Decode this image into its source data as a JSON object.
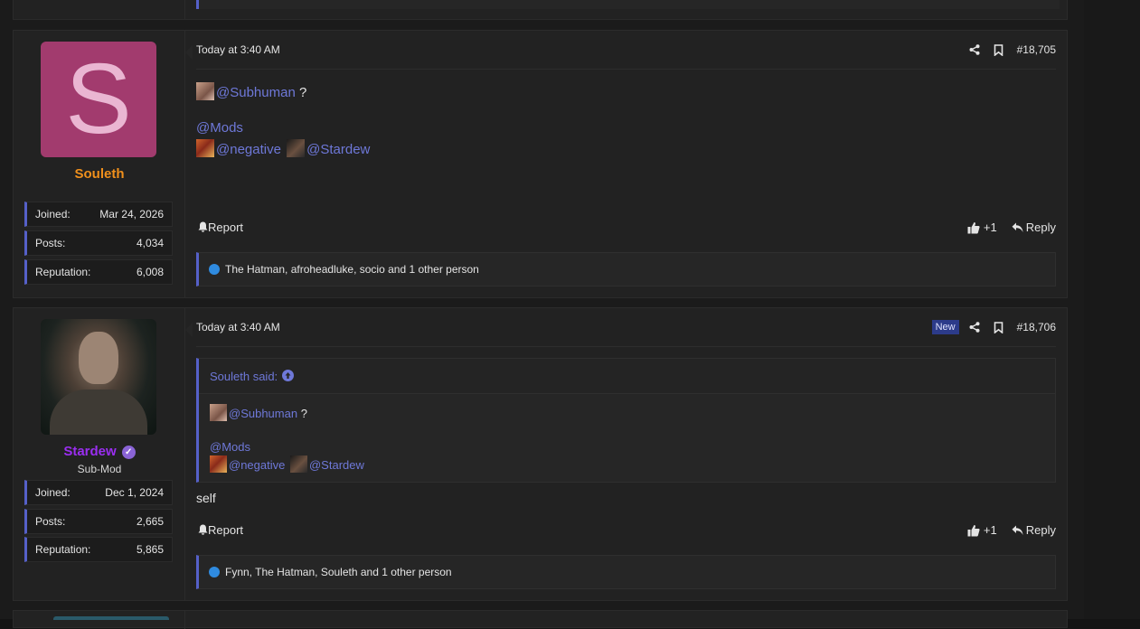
{
  "posts": [
    {
      "date": "Today at 3:40 AM",
      "post_number": "#18,705",
      "user": {
        "avatar_letter": "S",
        "avatar_color": "#a23b6e",
        "name": "Souleth",
        "name_color": "#f0901c",
        "stats": [
          {
            "label": "Joined:",
            "value": "Mar 24, 2026"
          },
          {
            "label": "Posts:",
            "value": "4,034"
          },
          {
            "label": "Reputation:",
            "value": "6,008"
          }
        ]
      },
      "body": {
        "line1_mention": "@Subhuman",
        "line1_after": " ?",
        "line2_mention": "@Mods",
        "line3_mention_a": "@negative",
        "line3_mention_b": "@Stardew"
      },
      "actions": {
        "report": "Report",
        "like_count": "+1",
        "reply": "Reply"
      },
      "reactions": "The Hatman, afroheadluke, socio and 1 other person"
    },
    {
      "date": "Today at 3:40 AM",
      "new_badge": "New",
      "post_number": "#18,706",
      "user": {
        "name": "Stardew",
        "name_color": "#9a2ef0",
        "title": "Sub-Mod",
        "stats": [
          {
            "label": "Joined:",
            "value": "Dec 1, 2024"
          },
          {
            "label": "Posts:",
            "value": "2,665"
          },
          {
            "label": "Reputation:",
            "value": "5,865"
          }
        ]
      },
      "quote": {
        "author": "Souleth said:",
        "line1_mention": "@Subhuman",
        "line1_after": " ?",
        "line2_mention": "@Mods",
        "line3_mention_a": "@negative",
        "line3_mention_b": "@Stardew"
      },
      "body_text": "self",
      "actions": {
        "report": "Report",
        "like_count": "+1",
        "reply": "Reply"
      },
      "reactions": "Fynn, The Hatman, Souleth and 1 other person"
    }
  ],
  "colors": {
    "accent": "#5560c8",
    "mention": "#6e78d8",
    "background": "#1b1b1b",
    "panel": "#222222"
  }
}
